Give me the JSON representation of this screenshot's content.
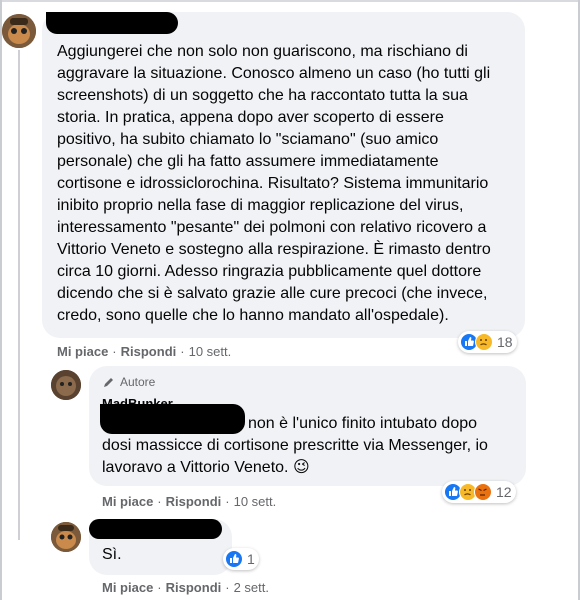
{
  "comments": [
    {
      "text_lines": [
        "Aggiungerei che non solo non guariscono, ma rischiano di",
        "aggravare la situazione. Conosco almeno un caso (ho tutti gli",
        "screenshots) di un soggetto che ha raccontato tutta la sua",
        "storia. In pratica, appena dopo aver scoperto di essere",
        "positivo, ha subito chiamato lo \"sciamano\" (suo amico",
        "personale) che gli ha fatto assumere immediatamente",
        "cortisone e idrossiclorochina. Risultato? Sistema immunitario",
        "inibito proprio nella fase di maggior replicazione del virus,",
        "interessamento \"pesante\" dei polmoni con relativo ricovero a",
        "Vittorio Veneto e sostegno alla respirazione. È rimasto dentro",
        "circa 10 giorni. Adesso ringrazia pubblicamente quel dottore",
        "dicendo che si è salvato grazie alle cure precoci (che invece,",
        "credo, sono quelle che lo hanno mandato all'ospedale)."
      ],
      "like": "Mi piace",
      "reply": "Rispondi",
      "time": "10 sett.",
      "reaction_count": "18"
    },
    {
      "badge": "Autore",
      "name_partial": "MadBunker",
      "text_lines": [
        "non è l'unico finito intubato dopo",
        "dosi massicce di cortisone prescritte via Messenger, io",
        "lavoravo a Vittorio Veneto. 😉"
      ],
      "like": "Mi piace",
      "reply": "Rispondi",
      "time": "10 sett.",
      "reaction_count": "12"
    },
    {
      "text_lines": [
        "Sì."
      ],
      "like": "Mi piace",
      "reply": "Rispondi",
      "time": "2 sett.",
      "reaction_count": "1"
    }
  ],
  "separator": "·",
  "colors": {
    "bubble": "#f0f2f5",
    "action_text": "#65676b",
    "like_blue": "#1877f2",
    "haha_yellow": "#f7b928",
    "angry_orange": "#e9710f",
    "redaction": "#000000"
  },
  "icons": [
    "pencil-icon",
    "like-reaction-icon",
    "sad-reaction-icon",
    "angry-reaction-icon"
  ]
}
